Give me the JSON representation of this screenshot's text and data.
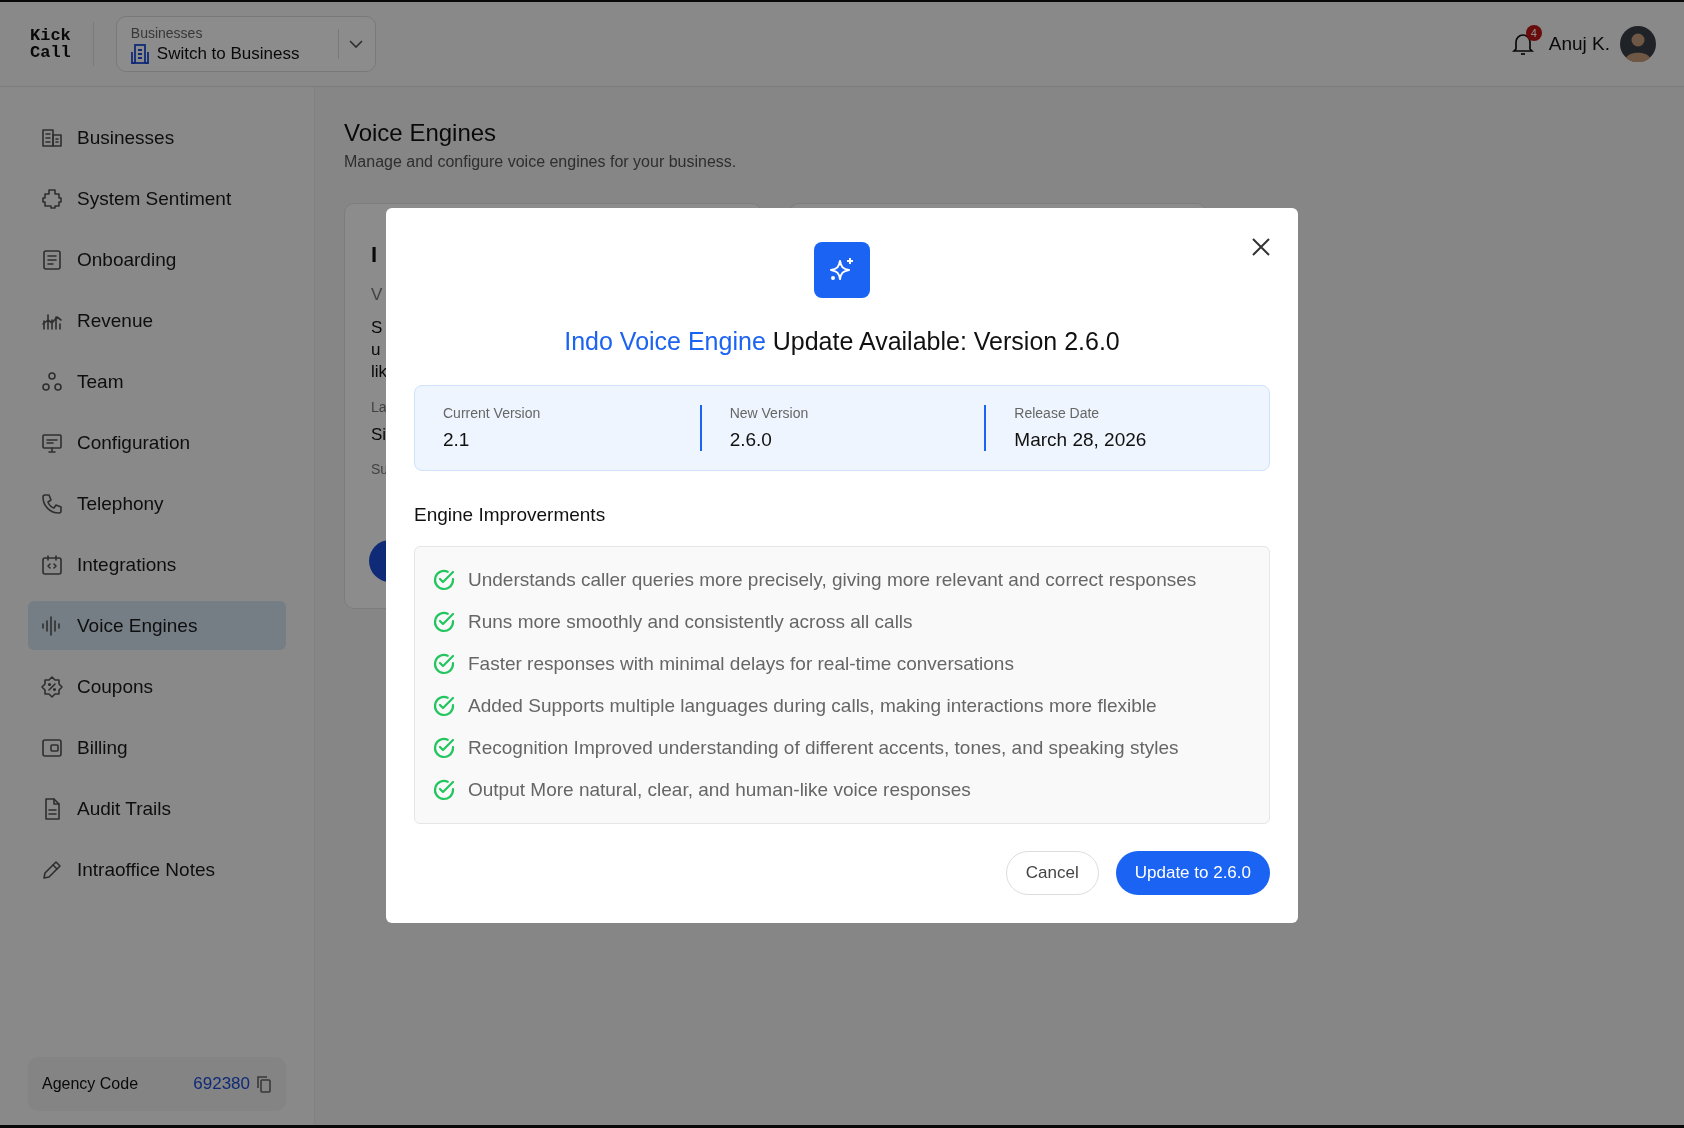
{
  "brand": {
    "lines": [
      "Kick",
      "Call"
    ]
  },
  "business_switcher": {
    "label": "Businesses",
    "value": "Switch to Business"
  },
  "header": {
    "notification_count": "4",
    "user_name": "Anuj K."
  },
  "sidebar": {
    "items": [
      {
        "label": "Businesses",
        "selected": false
      },
      {
        "label": "System Sentiment",
        "selected": false
      },
      {
        "label": "Onboarding",
        "selected": false
      },
      {
        "label": "Revenue",
        "selected": false
      },
      {
        "label": "Team",
        "selected": false
      },
      {
        "label": "Configuration",
        "selected": false
      },
      {
        "label": "Telephony",
        "selected": false
      },
      {
        "label": "Integrations",
        "selected": false
      },
      {
        "label": "Voice Engines",
        "selected": true
      },
      {
        "label": "Coupons",
        "selected": false
      },
      {
        "label": "Billing",
        "selected": false
      },
      {
        "label": "Audit Trails",
        "selected": false
      },
      {
        "label": "Intraoffice Notes",
        "selected": false
      }
    ],
    "agency_code": {
      "label": "Agency Code",
      "value": "692380"
    }
  },
  "page": {
    "title": "Voice Engines",
    "subtitle": "Manage and configure voice engines for your business.",
    "card_fragments": [
      "I",
      "V",
      "S",
      "u",
      "lik",
      "La",
      "Si",
      "Su"
    ]
  },
  "modal": {
    "title_highlight": "Indo Voice Engine",
    "title_rest": "Update Available: Version 2.6.0",
    "info": [
      {
        "label": "Current Version",
        "value": "2.1"
      },
      {
        "label": "New Version",
        "value": "2.6.0"
      },
      {
        "label": "Release Date",
        "value": "March 28, 2026"
      }
    ],
    "section_title": "Engine Improverments",
    "improvements": [
      "Understands caller queries more precisely, giving more relevant and correct responses",
      "Runs more smoothly and consistently across all calls",
      "Faster responses with minimal delays for real-time conversations",
      "Added Supports multiple languages during calls, making interactions more flexible",
      "Recognition Improved understanding of different accents, tones, and speaking styles",
      "Output More natural, clear, and human-like voice responses"
    ],
    "buttons": [
      {
        "label": "Cancel",
        "kind": "secondary"
      },
      {
        "label": "Update to 2.6.0",
        "kind": "primary"
      }
    ]
  }
}
